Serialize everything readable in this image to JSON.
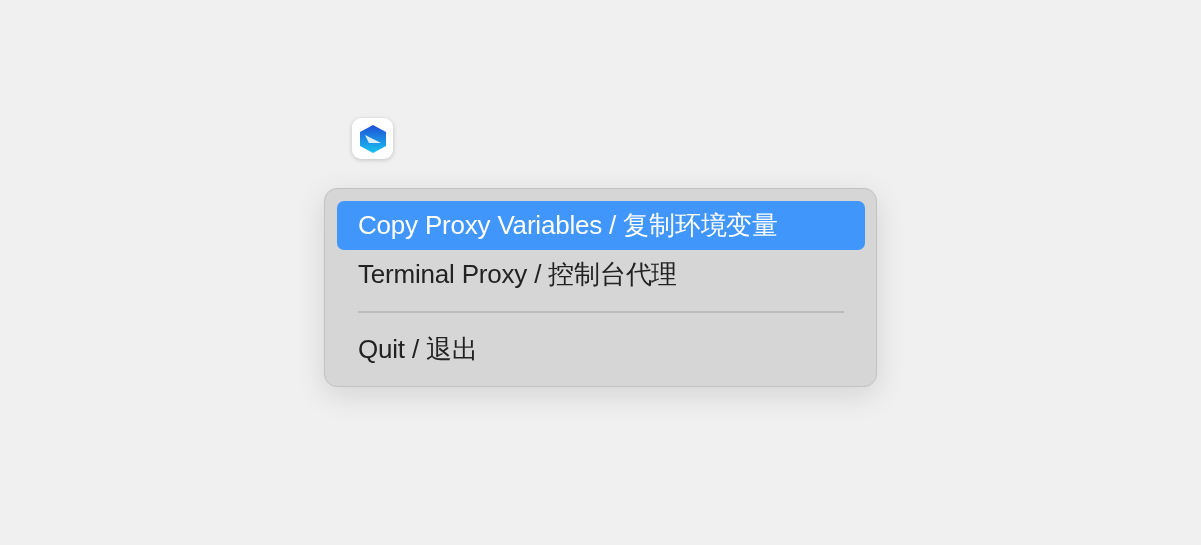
{
  "menu": {
    "items": [
      {
        "kind": "item",
        "label": "Copy Proxy Variables / 复制环境变量",
        "selected": true
      },
      {
        "kind": "item",
        "label": "Terminal Proxy / 控制台代理",
        "selected": false
      },
      {
        "kind": "separator"
      },
      {
        "kind": "item",
        "label": "Quit / 退出",
        "selected": false
      }
    ]
  }
}
